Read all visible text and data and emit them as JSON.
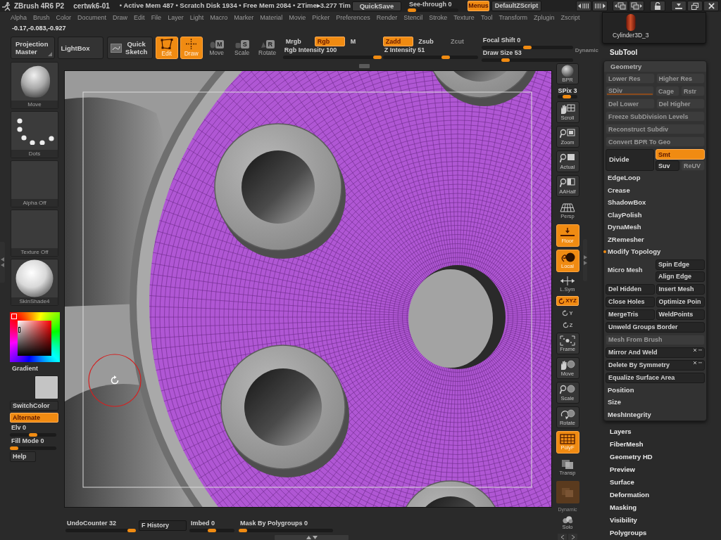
{
  "title_bar": {
    "app": "ZBrush 4R6 P2",
    "document": "certwk6-01",
    "stats": "• Active Mem 487 • Scratch Disk 1934 • Free Mem 2084 • ZTime▸3.277 Tim",
    "quicksave": "QuickSave",
    "see_through": {
      "label": "See-through",
      "value": "0",
      "level": 0
    },
    "menus": {
      "label": "Menus",
      "on": true
    },
    "script": "DefaultZScript"
  },
  "menu_bar": [
    "Alpha",
    "Brush",
    "Color",
    "Document",
    "Draw",
    "Edit",
    "File",
    "Layer",
    "Light",
    "Macro",
    "Marker",
    "Material",
    "Movie",
    "Picker",
    "Preferences",
    "Render",
    "Stencil",
    "Stroke",
    "Texture",
    "Tool",
    "Transform",
    "Zplugin",
    "Zscript"
  ],
  "coordinates": "-0.17,-0.083,-0.927",
  "top_shelf": {
    "projection_master": "Projection Master",
    "lightbox": "LightBox",
    "quick_sketch": "Quick Sketch",
    "modes": [
      {
        "kind": "edit",
        "label": "Edit",
        "on": true
      },
      {
        "kind": "draw",
        "label": "Draw",
        "on": true
      },
      {
        "kind": "move",
        "key": "M",
        "label": "Move",
        "on": false
      },
      {
        "kind": "scale",
        "key": "S",
        "label": "Scale",
        "on": false
      },
      {
        "kind": "rotate",
        "key": "R",
        "label": "Rotate",
        "on": false
      }
    ],
    "color_modes": [
      {
        "label": "Mrgb",
        "on": false
      },
      {
        "label": "Rgb",
        "on": true
      },
      {
        "label": "M",
        "on": false
      }
    ],
    "rgb_intensity": {
      "label": "Rgb Intensity",
      "value": "100",
      "level": 1
    },
    "z_modes": [
      {
        "label": "Zadd",
        "on": true,
        "disabled": false
      },
      {
        "label": "Zsub",
        "on": false,
        "disabled": false
      },
      {
        "label": "Zcut",
        "on": false,
        "disabled": true
      }
    ],
    "z_intensity": {
      "label": "Z Intensity",
      "value": "51",
      "level": 0.68
    },
    "focal_shift": {
      "label": "Focal Shift",
      "value": "0",
      "level": 0.5
    },
    "draw_size": {
      "label": "Draw Size",
      "value": "53",
      "level": 0.24
    },
    "dynamic": {
      "label": "Dynamic",
      "disabled": true
    }
  },
  "left_shelf": {
    "brush": "Move",
    "stroke": "Dots",
    "alpha": "Alpha Off",
    "texture": "Texture Off",
    "material": "SkinShade4",
    "gradient": "Gradient",
    "switch_color": "SwitchColor",
    "alternate": {
      "label": "Alternate",
      "on": true
    },
    "elv": {
      "label": "Elv",
      "value": "0",
      "level": 0.5
    },
    "fill_mode": {
      "label": "Fill Mode",
      "value": "0",
      "level": 0
    },
    "help": "Help"
  },
  "right_toolbar": [
    {
      "kind": "bpr",
      "label": "BPR",
      "on": false
    },
    {
      "kind": "spix",
      "label": "SPix",
      "value": "3",
      "level": 0.45,
      "on": false
    },
    {
      "kind": "scroll",
      "label": "Scroll",
      "on": false
    },
    {
      "kind": "zoom",
      "label": "Zoom",
      "on": false
    },
    {
      "kind": "actual",
      "label": "Actual",
      "on": false
    },
    {
      "kind": "aahalf",
      "label": "AAHalf",
      "on": false
    },
    {
      "kind": "persp",
      "label": "Persp",
      "on": false
    },
    {
      "kind": "floor",
      "label": "Floor",
      "on": true
    },
    {
      "kind": "local",
      "label": "Local",
      "on": true
    },
    {
      "kind": "lsym",
      "label": "L.Sym",
      "on": false
    },
    {
      "kind": "xyz",
      "label": "XYZ",
      "on": true
    },
    {
      "kind": "axis",
      "label": "Y",
      "on": false
    },
    {
      "kind": "axis",
      "label": "Z",
      "on": false
    },
    {
      "kind": "frame",
      "label": "Frame",
      "on": false
    },
    {
      "kind": "move",
      "label": "Move",
      "on": false
    },
    {
      "kind": "scale",
      "label": "Scale",
      "on": false
    },
    {
      "kind": "rotate",
      "label": "Rotate",
      "on": false
    },
    {
      "kind": "polyf",
      "label": "PolyF",
      "on": true
    },
    {
      "kind": "transp",
      "label": "Transp",
      "on": false
    },
    {
      "kind": "ghost",
      "on": false
    },
    {
      "kind": "caption",
      "label": "Dynamic",
      "on": false
    },
    {
      "kind": "solo",
      "label": "Solo",
      "on": false
    }
  ],
  "bottom_bar": {
    "undo_counter": {
      "label": "UndoCounter",
      "value": "32",
      "level": 1
    },
    "history": "F History",
    "imbed": {
      "label": "Imbed",
      "value": "0",
      "level": 0.5
    },
    "mask_by_polygroups": {
      "label": "Mask By Polygroups",
      "value": "0",
      "level": 0
    }
  },
  "right_panel": {
    "subtool": "Cylinder3D_3",
    "subtool_title": "SubTool",
    "geometry": {
      "title": "Geometry",
      "rows": [
        {
          "kind": "pair",
          "buttons": [
            {
              "label": "Lower Res",
              "disabled": true
            },
            {
              "label": "Higher Res",
              "disabled": true
            }
          ]
        },
        {
          "kind": "sdiv",
          "slider": {
            "label": "SDiv",
            "disabled": true,
            "level": 1
          },
          "buttons": [
            {
              "label": "Cage",
              "disabled": true
            },
            {
              "label": "Rstr",
              "disabled": true
            }
          ]
        },
        {
          "kind": "pair",
          "buttons": [
            {
              "label": "Del Lower",
              "disabled": true
            },
            {
              "label": "Del Higher",
              "disabled": true
            }
          ]
        },
        {
          "kind": "wide",
          "label": "Freeze SubDivision Levels",
          "disabled": true,
          "options": false
        },
        {
          "kind": "wide",
          "label": "Reconstruct Subdiv",
          "disabled": true,
          "options": false
        },
        {
          "kind": "wide",
          "label": "Convert BPR To Geo",
          "disabled": true,
          "options": false
        },
        {
          "kind": "divide",
          "label": "Divide",
          "buttons": [
            {
              "label": "Smt",
              "on": true,
              "disabled": false
            },
            {
              "label": "Suv",
              "on": false,
              "disabled": false
            },
            {
              "label": "ReUV",
              "on": false,
              "disabled": true
            }
          ]
        },
        {
          "kind": "subpalette",
          "label": "EdgeLoop",
          "expanded": false
        },
        {
          "kind": "subpalette",
          "label": "Crease",
          "expanded": false
        },
        {
          "kind": "subpalette",
          "label": "ShadowBox",
          "expanded": false
        },
        {
          "kind": "subpalette",
          "label": "ClayPolish",
          "expanded": false
        },
        {
          "kind": "subpalette",
          "label": "DynaMesh",
          "expanded": false
        },
        {
          "kind": "subpalette",
          "label": "ZRemesher",
          "expanded": false
        },
        {
          "kind": "subpalette",
          "label": "Modify Topology",
          "expanded": true,
          "children": [
            {
              "kind": "micro_mesh",
              "label": "Micro Mesh",
              "buttons": [
                {
                  "label": "Spin Edge",
                  "disabled": false
                },
                {
                  "label": "Align Edge",
                  "disabled": false
                }
              ]
            },
            {
              "kind": "pair",
              "buttons": [
                {
                  "label": "Del Hidden",
                  "disabled": false
                },
                {
                  "label": "Insert Mesh",
                  "disabled": false
                }
              ]
            },
            {
              "kind": "pair",
              "buttons": [
                {
                  "label": "Close Holes",
                  "disabled": false
                },
                {
                  "label": "Optimize Poin",
                  "disabled": false
                }
              ]
            },
            {
              "kind": "pair",
              "buttons": [
                {
                  "label": "MergeTris",
                  "disabled": false
                },
                {
                  "label": "WeldPoints",
                  "disabled": false
                }
              ]
            },
            {
              "kind": "wide",
              "label": "Unweld Groups Border",
              "disabled": false,
              "options": false
            },
            {
              "kind": "wide",
              "label": "Mesh From Brush",
              "disabled": true,
              "options": false
            },
            {
              "kind": "wide",
              "label": "Mirror And Weld",
              "disabled": false,
              "options": true
            },
            {
              "kind": "wide",
              "label": "Delete By Symmetry",
              "disabled": false,
              "options": true
            },
            {
              "kind": "wide",
              "label": "Equalize Surface Area",
              "disabled": false,
              "options": false
            }
          ]
        },
        {
          "kind": "subpalette",
          "label": "Position",
          "expanded": false
        },
        {
          "kind": "subpalette",
          "label": "Size",
          "expanded": false
        },
        {
          "kind": "subpalette",
          "label": "MeshIntegrity",
          "expanded": false
        }
      ]
    },
    "palettes": [
      "Layers",
      "FiberMesh",
      "Geometry HD",
      "Preview",
      "Surface",
      "Deformation",
      "Masking",
      "Visibility",
      "Polygroups"
    ]
  }
}
